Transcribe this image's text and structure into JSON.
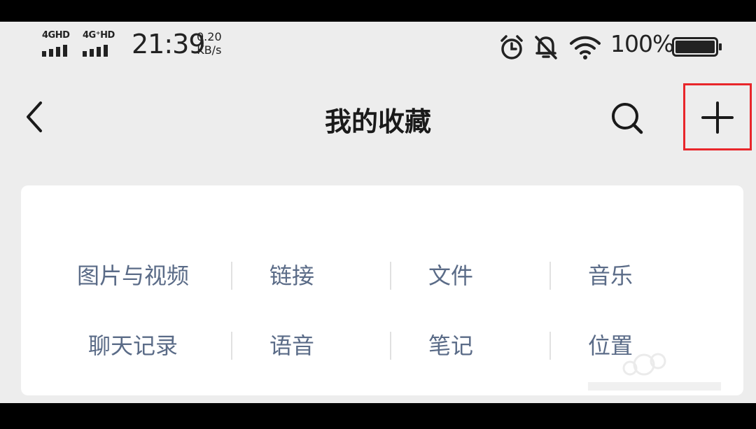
{
  "status_bar": {
    "network1": "4GHD",
    "network2": "4G⁺HD",
    "time": "21:39",
    "speed_value": "0.20",
    "speed_unit": "KB/s",
    "icons": [
      "alarm-icon",
      "mute-icon",
      "wifi-icon"
    ],
    "battery_percent": "100%",
    "battery_level": 1.0
  },
  "header": {
    "back_icon": "chevron-left-icon",
    "title": "我的收藏",
    "search_icon": "search-icon",
    "add_icon": "plus-icon",
    "highlight_color": "#e8262b"
  },
  "categories": [
    [
      "图片与视频",
      "链接",
      "文件",
      "音乐"
    ],
    [
      "聊天记录",
      "语音",
      "笔记",
      "位置"
    ]
  ],
  "colors": {
    "category_text": "#5a6b87",
    "background": "#ededed",
    "card": "#ffffff"
  }
}
